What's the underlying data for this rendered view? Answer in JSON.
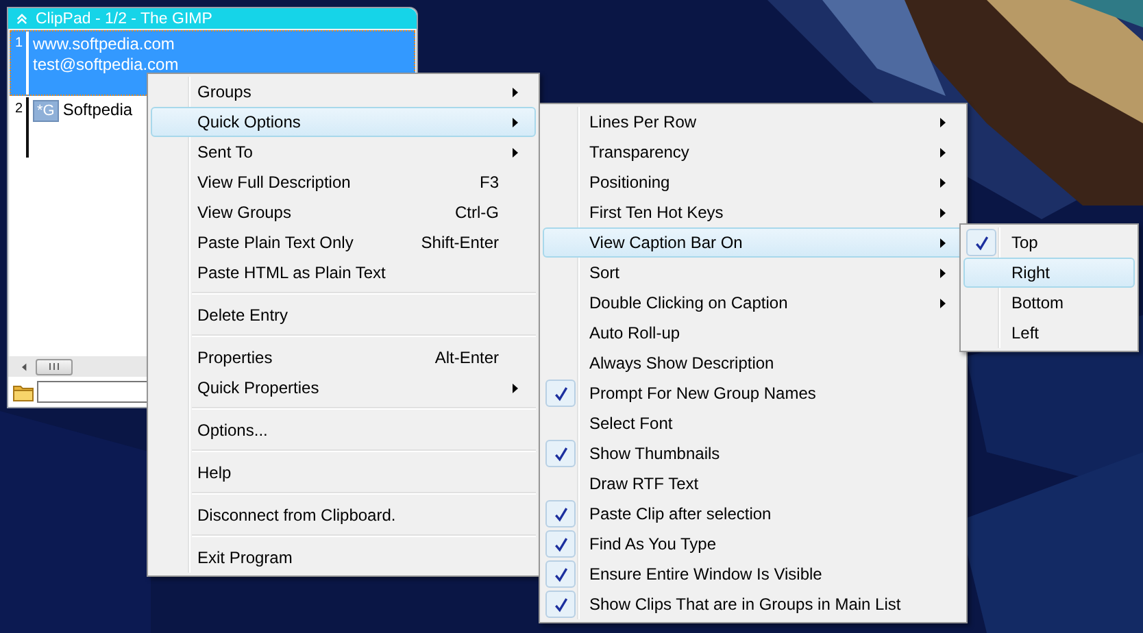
{
  "clippad": {
    "title": "ClipPad - 1/2 - The GIMP",
    "rows": [
      {
        "number": "1",
        "lines": [
          "www.softpedia.com",
          "test@softpedia.com"
        ],
        "selected": true
      },
      {
        "number": "2",
        "badge": "*G",
        "lines": [
          "Softpedia"
        ],
        "selected": false
      }
    ]
  },
  "context_menu": {
    "items": [
      {
        "kind": "item",
        "label": "Groups",
        "submenu": true,
        "selected": false
      },
      {
        "kind": "item",
        "label": "Quick Options",
        "submenu": true,
        "selected": true
      },
      {
        "kind": "item",
        "label": "Sent To",
        "submenu": true,
        "selected": false
      },
      {
        "kind": "item",
        "label": "View Full Description",
        "shortcut": "F3",
        "selected": false
      },
      {
        "kind": "item",
        "label": "View Groups",
        "shortcut": "Ctrl-G",
        "selected": false
      },
      {
        "kind": "item",
        "label": "Paste Plain Text Only",
        "shortcut": "Shift-Enter",
        "selected": false
      },
      {
        "kind": "item",
        "label": "Paste HTML as Plain Text",
        "selected": false
      },
      {
        "kind": "separator"
      },
      {
        "kind": "item",
        "label": "Delete Entry",
        "selected": false
      },
      {
        "kind": "separator"
      },
      {
        "kind": "item",
        "label": "Properties",
        "shortcut": "Alt-Enter",
        "selected": false
      },
      {
        "kind": "item",
        "label": "Quick Properties",
        "submenu": true,
        "selected": false
      },
      {
        "kind": "separator"
      },
      {
        "kind": "item",
        "label": "Options...",
        "selected": false
      },
      {
        "kind": "separator"
      },
      {
        "kind": "item",
        "label": "Help",
        "selected": false
      },
      {
        "kind": "separator"
      },
      {
        "kind": "item",
        "label": "Disconnect from Clipboard.",
        "selected": false
      },
      {
        "kind": "separator"
      },
      {
        "kind": "item",
        "label": "Exit Program",
        "selected": false
      }
    ]
  },
  "quick_options_menu": {
    "items": [
      {
        "kind": "item",
        "label": "Lines Per Row",
        "submenu": true,
        "checked": false,
        "selected": false
      },
      {
        "kind": "item",
        "label": "Transparency",
        "submenu": true,
        "checked": false,
        "selected": false
      },
      {
        "kind": "item",
        "label": "Positioning",
        "submenu": true,
        "checked": false,
        "selected": false
      },
      {
        "kind": "item",
        "label": "First Ten Hot Keys",
        "submenu": true,
        "checked": false,
        "selected": false
      },
      {
        "kind": "item",
        "label": "View Caption Bar On",
        "submenu": true,
        "checked": false,
        "selected": true
      },
      {
        "kind": "item",
        "label": "Sort",
        "submenu": true,
        "checked": false,
        "selected": false
      },
      {
        "kind": "item",
        "label": "Double Clicking on Caption",
        "submenu": true,
        "checked": false,
        "selected": false
      },
      {
        "kind": "item",
        "label": "Auto Roll-up",
        "checked": false,
        "selected": false
      },
      {
        "kind": "item",
        "label": "Always Show Description",
        "checked": false,
        "selected": false
      },
      {
        "kind": "item",
        "label": "Prompt For New Group Names",
        "checked": true,
        "selected": false
      },
      {
        "kind": "item",
        "label": "Select Font",
        "checked": false,
        "selected": false
      },
      {
        "kind": "item",
        "label": "Show Thumbnails",
        "checked": true,
        "selected": false
      },
      {
        "kind": "item",
        "label": "Draw RTF Text",
        "checked": false,
        "selected": false
      },
      {
        "kind": "item",
        "label": "Paste Clip after selection",
        "checked": true,
        "selected": false
      },
      {
        "kind": "item",
        "label": "Find As You Type",
        "checked": true,
        "selected": false
      },
      {
        "kind": "item",
        "label": "Ensure Entire Window Is Visible",
        "checked": true,
        "selected": false
      },
      {
        "kind": "item",
        "label": "Show Clips That are in Groups in Main List",
        "checked": true,
        "selected": false
      }
    ]
  },
  "caption_bar_menu": {
    "items": [
      {
        "kind": "item",
        "label": "Top",
        "checked": true,
        "selected": false
      },
      {
        "kind": "item",
        "label": "Right",
        "checked": false,
        "selected": true
      },
      {
        "kind": "item",
        "label": "Bottom",
        "checked": false,
        "selected": false
      },
      {
        "kind": "item",
        "label": "Left",
        "checked": false,
        "selected": false
      }
    ]
  }
}
